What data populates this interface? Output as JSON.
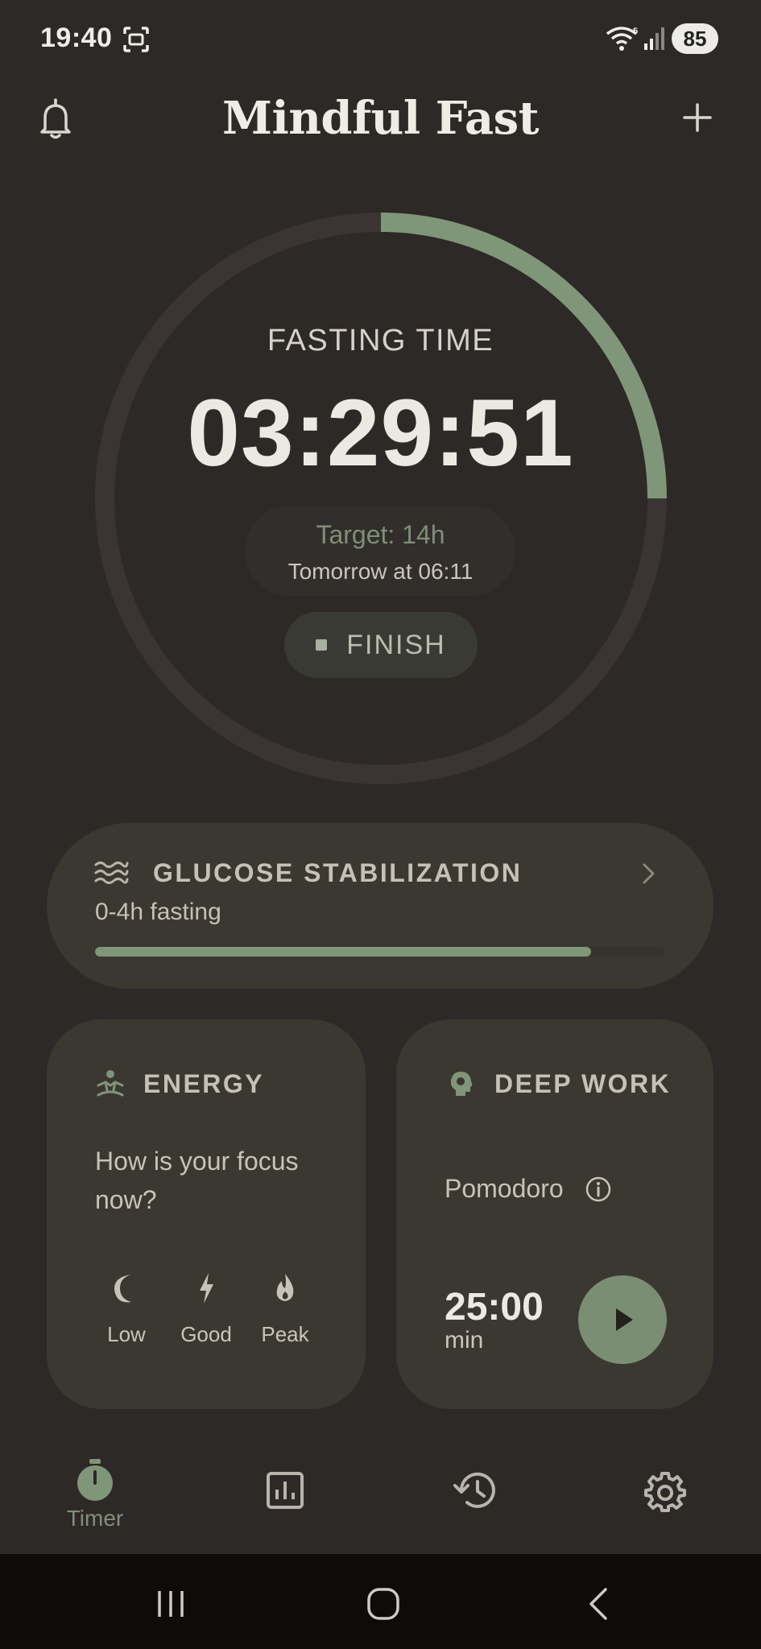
{
  "status_bar": {
    "time": "19:40",
    "battery": "85"
  },
  "header": {
    "title": "Mindful Fast"
  },
  "timer": {
    "label": "FASTING TIME",
    "elapsed": "03:29:51",
    "target_label": "Target: 14h",
    "target_end": "Tomorrow at 06:11",
    "finish_label": "FINISH",
    "ring_progress": 0.25,
    "accent_color": "#7f9678"
  },
  "glucose": {
    "title": "GLUCOSE STABILIZATION",
    "subtitle": "0-4h fasting",
    "progress": 0.87
  },
  "energy": {
    "title": "ENERGY",
    "question": "How is your focus now?",
    "options": [
      {
        "label": "Low",
        "icon": "moon-icon"
      },
      {
        "label": "Good",
        "icon": "bolt-icon"
      },
      {
        "label": "Peak",
        "icon": "flame-icon"
      }
    ]
  },
  "deep_work": {
    "title": "DEEP WORK",
    "mode": "Pomodoro",
    "duration": "25:00",
    "unit": "min"
  },
  "bottom_nav": {
    "items": [
      {
        "label": "Timer",
        "icon": "stopwatch-icon",
        "active": true
      },
      {
        "label": "",
        "icon": "bar-chart-icon",
        "active": false
      },
      {
        "label": "",
        "icon": "history-icon",
        "active": false
      },
      {
        "label": "",
        "icon": "settings-gear-icon",
        "active": false
      }
    ]
  }
}
